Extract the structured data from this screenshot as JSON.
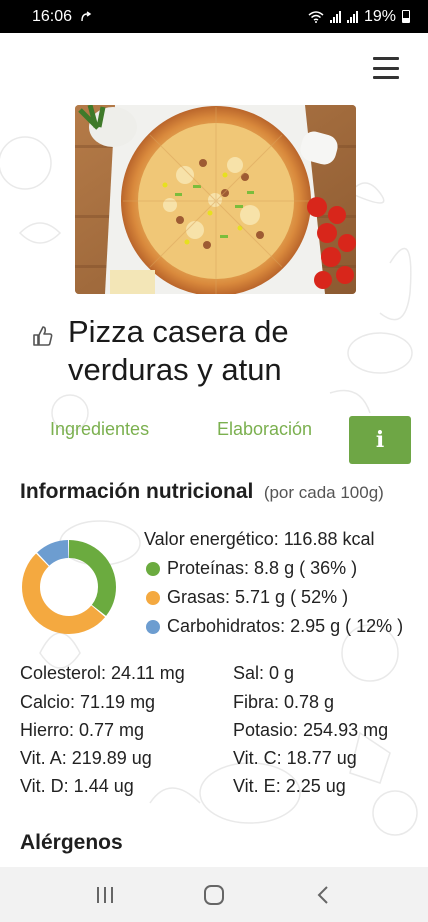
{
  "status_bar": {
    "time": "16:06",
    "battery": "19%"
  },
  "recipe": {
    "title": "Pizza casera de verduras y atun"
  },
  "tabs": [
    {
      "label": "Ingredientes"
    },
    {
      "label": "Elaboración"
    },
    {
      "label": "i"
    }
  ],
  "nutrition": {
    "heading": "Información nutricional",
    "per": "(por cada 100g)",
    "energy": "Valor energético: 116.88 kcal",
    "macros": [
      {
        "label": "Proteínas: 8.8 g ( 36% )",
        "percent": 36,
        "color": "#6bab3f"
      },
      {
        "label": "Grasas: 5.71 g ( 52% )",
        "percent": 52,
        "color": "#f4a940"
      },
      {
        "label": "Carbohidratos: 2.95 g ( 12% )",
        "percent": 12,
        "color": "#6d9dd0"
      }
    ],
    "details": [
      "Colesterol: 24.11 mg",
      "Sal: 0 g",
      "Calcio: 71.19 mg",
      "Fibra: 0.78 g",
      "Hierro: 0.77 mg",
      "Potasio: 254.93 mg",
      "Vit. A: 219.89 ug",
      "Vit. C: 18.77 ug",
      "Vit. D: 1.44 ug",
      "Vit. E: 2.25 ug"
    ]
  },
  "allergens": {
    "heading": "Alérgenos"
  },
  "icons": {
    "menu": "hamburger-menu-icon",
    "like": "thumbs-up-icon",
    "info": "info-icon",
    "nav_recents": "recents-icon",
    "nav_home": "home-icon",
    "nav_back": "back-icon"
  }
}
